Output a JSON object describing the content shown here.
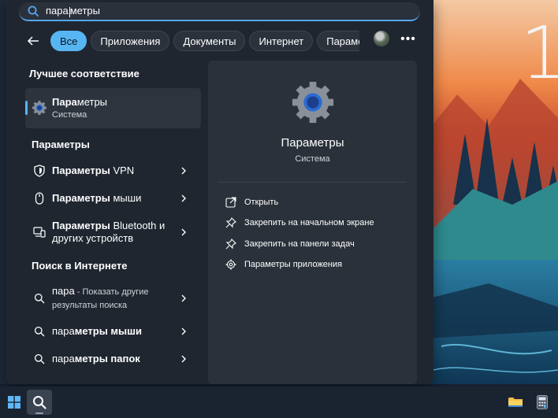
{
  "search": {
    "value_bold": "пара",
    "value_rest": "метры",
    "icon": "search-icon"
  },
  "filters": {
    "back_icon": "back-arrow-icon",
    "chips": [
      {
        "label": "Все",
        "active": true
      },
      {
        "label": "Приложения"
      },
      {
        "label": "Документы"
      },
      {
        "label": "Интернет"
      },
      {
        "label": "Параме"
      }
    ],
    "more_label": "•••"
  },
  "best_match": {
    "title": "Лучшее соответствие",
    "name_bold": "Пара",
    "name_rest": "метры",
    "subtitle": "Система"
  },
  "settings_section": {
    "title": "Параметры",
    "items": [
      {
        "bold": "Параметры",
        "rest": " VPN",
        "icon": "shield-icon"
      },
      {
        "bold": "Параметры",
        "rest": " мыши",
        "icon": "mouse-icon"
      },
      {
        "bold": "Параметры",
        "rest": " Bluetooth и других устройств",
        "icon": "devices-icon"
      }
    ]
  },
  "web_section": {
    "title": "Поиск в Интернете",
    "items": [
      {
        "bold": "пара",
        "rest": " - Показать другие результаты поиска"
      },
      {
        "bold": "пара",
        "rest": "метры мыши"
      },
      {
        "bold": "пара",
        "rest": "метры папок"
      }
    ]
  },
  "preview": {
    "title": "Параметры",
    "subtitle": "Система",
    "actions": [
      {
        "label": "Открыть",
        "icon": "open-external-icon"
      },
      {
        "label": "Закрепить на начальном экране",
        "icon": "pin-icon"
      },
      {
        "label": "Закрепить на панели задач",
        "icon": "pin-icon"
      },
      {
        "label": "Параметры приложения",
        "icon": "gear-icon"
      }
    ]
  },
  "desktop": {
    "clock_fragment": "1"
  },
  "colors": {
    "accent": "#57b5f2",
    "panel": "#1f2630",
    "preview": "#2a313a"
  }
}
